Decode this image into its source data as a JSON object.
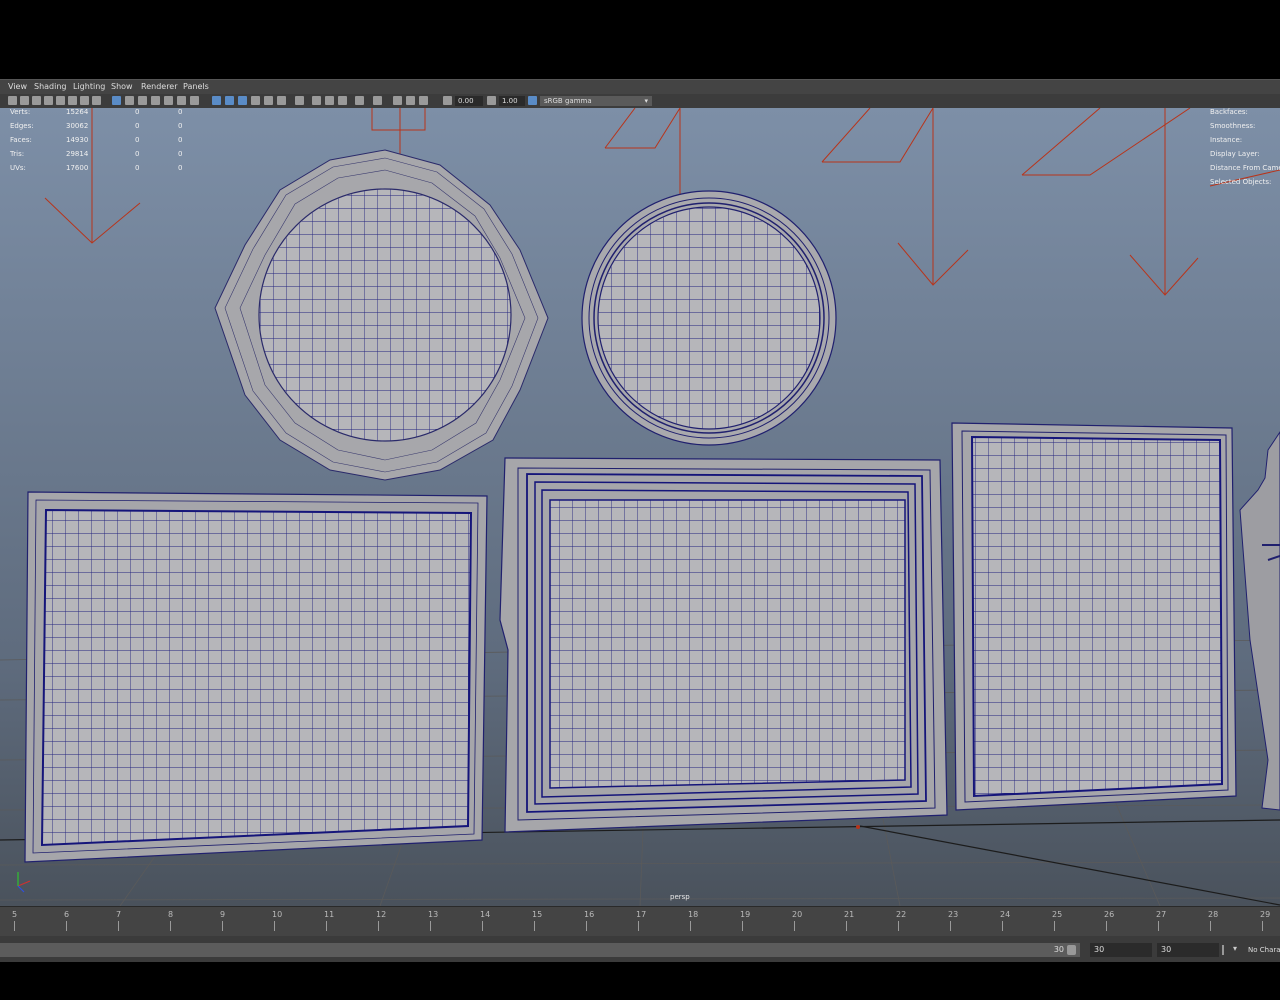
{
  "menus": [
    "View",
    "Shading",
    "Lighting",
    "Show",
    "Renderer",
    "Panels"
  ],
  "toolbar": {
    "exposure_value": "0.00",
    "gamma_value": "1.00",
    "color_space": "sRGB gamma"
  },
  "hud_left": {
    "rows": [
      {
        "label": "Verts:",
        "v1": "15264",
        "v2": "0",
        "v3": "0"
      },
      {
        "label": "Edges:",
        "v1": "30062",
        "v2": "0",
        "v3": "0"
      },
      {
        "label": "Faces:",
        "v1": "14930",
        "v2": "0",
        "v3": "0"
      },
      {
        "label": "Tris:",
        "v1": "29814",
        "v2": "0",
        "v3": "0"
      },
      {
        "label": "UVs:",
        "v1": "17600",
        "v2": "0",
        "v3": "0"
      }
    ]
  },
  "hud_right": {
    "rows": [
      "Backfaces:",
      "Smoothness:",
      "Instance:",
      "Display Layer:",
      "Distance From Camera:",
      "Selected Objects:"
    ]
  },
  "camera_label": "persp",
  "timeline": {
    "frames": [
      "5",
      "6",
      "7",
      "8",
      "9",
      "10",
      "11",
      "12",
      "13",
      "14",
      "15",
      "16",
      "17",
      "18",
      "19",
      "20",
      "21",
      "22",
      "23",
      "24",
      "25",
      "26",
      "27",
      "28",
      "29"
    ]
  },
  "range": {
    "end_value": "30",
    "anim_end": "30",
    "max_end": "30",
    "character_set": "No Character Set"
  },
  "colors": {
    "viewport_top": "#7d8fa7",
    "viewport_bottom": "#4d5560",
    "wire": "#1c1c7a",
    "mesh": "#b4b4b8",
    "light": "#b8341a"
  }
}
